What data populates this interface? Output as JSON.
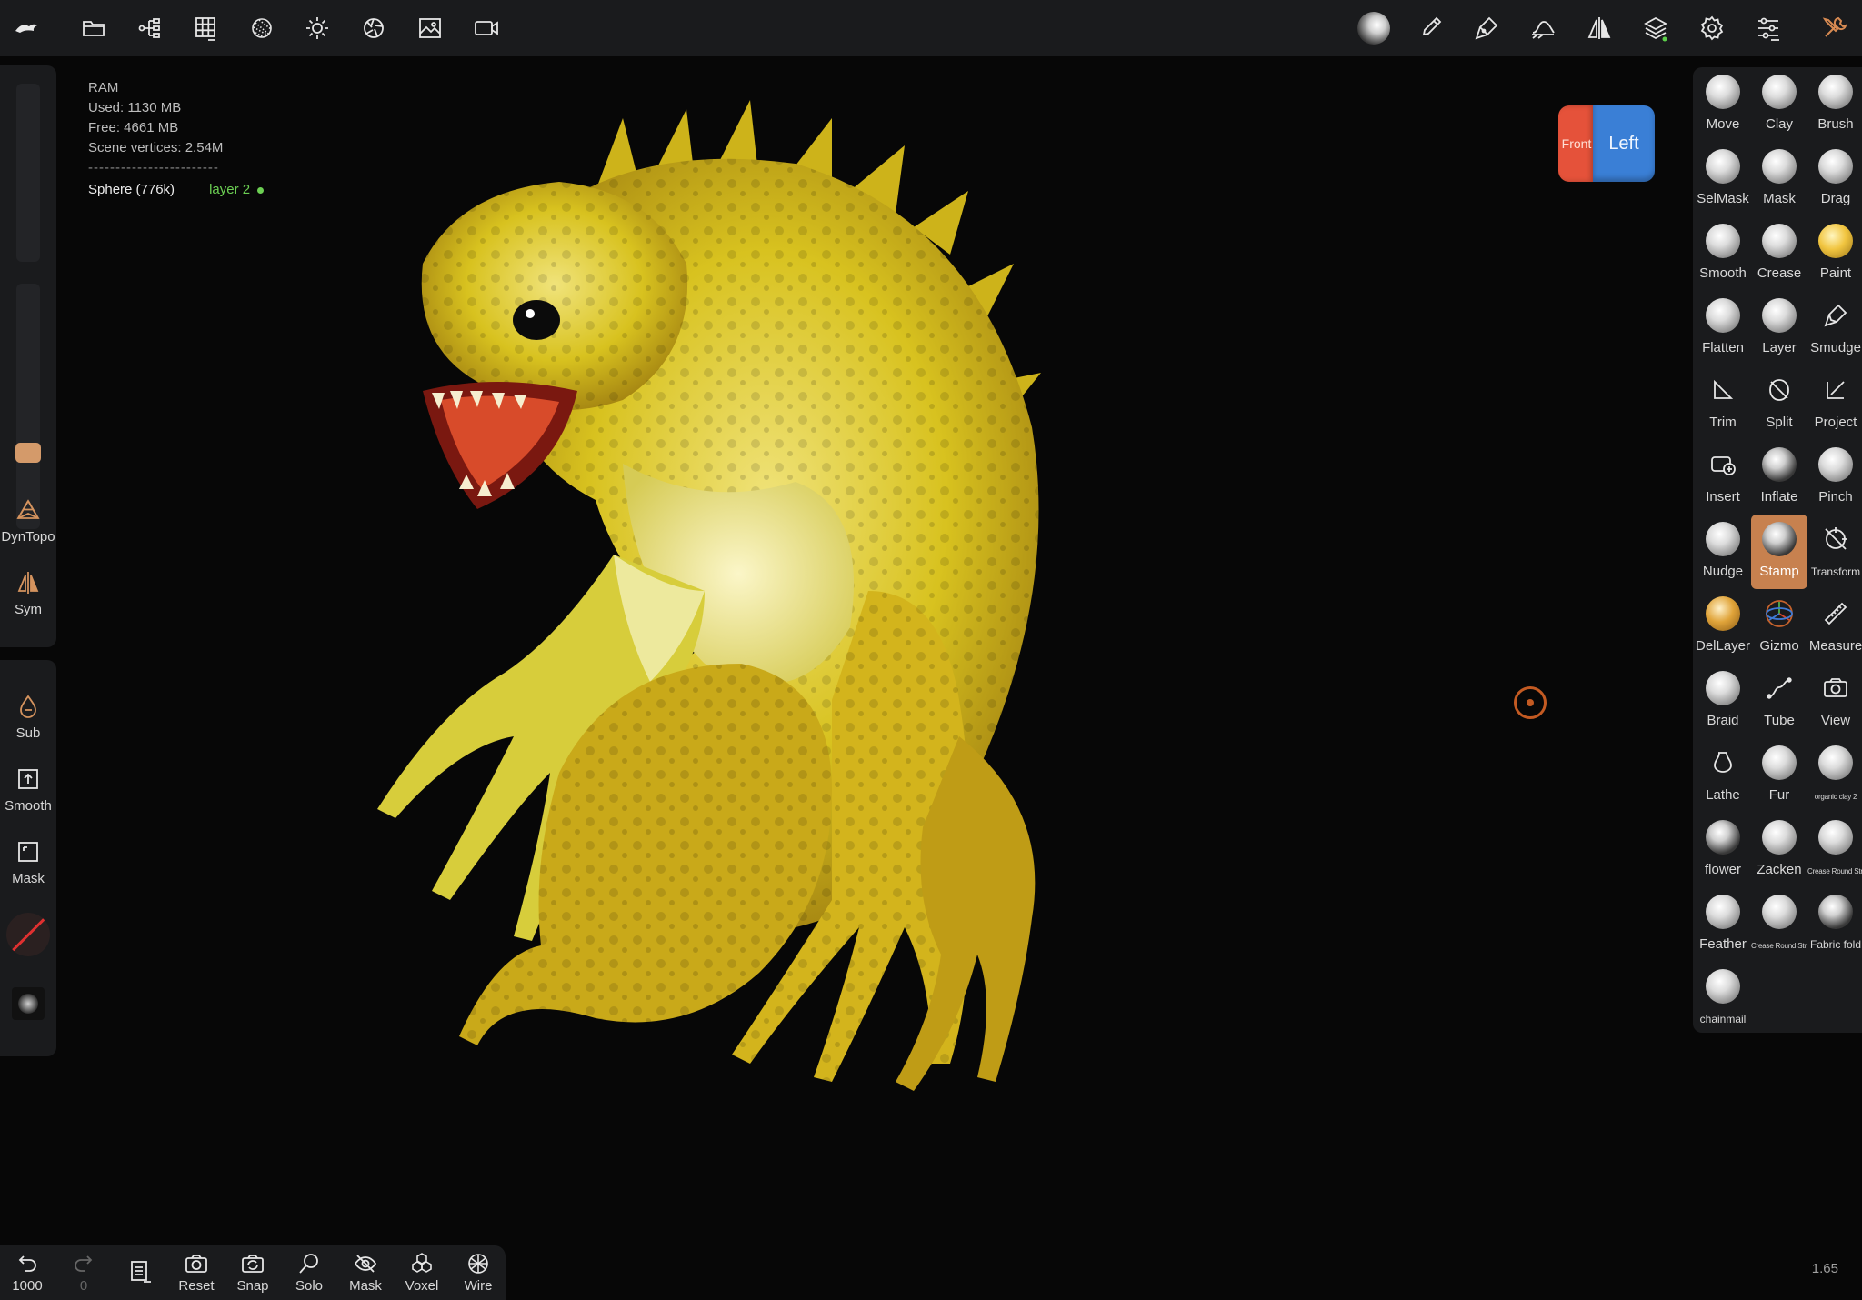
{
  "stats": {
    "ram_label": "RAM",
    "used": "Used: 1130 MB",
    "free": "Free: 4661 MB",
    "vertices": "Scene vertices: 2.54M",
    "separator": "------------------------",
    "object": "Sphere (776k)",
    "layer": "layer 2"
  },
  "viewcube": {
    "front": "Front",
    "left": "Left"
  },
  "left_tools": {
    "dyntopo": "DynTopo",
    "sym": "Sym",
    "sub": "Sub",
    "smooth": "Smooth",
    "mask": "Mask"
  },
  "bottom": {
    "undo": "1000",
    "redo": "0",
    "reset": "Reset",
    "snap": "Snap",
    "solo": "Solo",
    "mask": "Mask",
    "voxel": "Voxel",
    "wire": "Wire"
  },
  "version": "1.65",
  "tools": [
    {
      "label": "Move",
      "icon": "move-ball"
    },
    {
      "label": "Clay",
      "icon": "clay-ball"
    },
    {
      "label": "Brush",
      "icon": "brush-ball"
    },
    {
      "label": "SelMask",
      "icon": "selmask-ball"
    },
    {
      "label": "Mask",
      "icon": "mask-ball"
    },
    {
      "label": "Drag",
      "icon": "drag-ball"
    },
    {
      "label": "Smooth",
      "icon": "smooth-ball"
    },
    {
      "label": "Crease",
      "icon": "crease-ball"
    },
    {
      "label": "Paint",
      "icon": "paint-ball"
    },
    {
      "label": "Flatten",
      "icon": "flatten-ball"
    },
    {
      "label": "Layer",
      "icon": "layer-ball"
    },
    {
      "label": "Smudge",
      "icon": "smudge-icon"
    },
    {
      "label": "Trim",
      "icon": "trim-icon"
    },
    {
      "label": "Split",
      "icon": "split-icon"
    },
    {
      "label": "Project",
      "icon": "project-icon"
    },
    {
      "label": "Insert",
      "icon": "insert-icon"
    },
    {
      "label": "Inflate",
      "icon": "inflate-ball"
    },
    {
      "label": "Pinch",
      "icon": "pinch-ball"
    },
    {
      "label": "Nudge",
      "icon": "nudge-ball"
    },
    {
      "label": "Stamp",
      "icon": "stamp-ball"
    },
    {
      "label": "Transform",
      "icon": "transform-icon"
    },
    {
      "label": "DelLayer",
      "icon": "dellayer-ball"
    },
    {
      "label": "Gizmo",
      "icon": "gizmo-icon"
    },
    {
      "label": "Measure",
      "icon": "measure-icon"
    },
    {
      "label": "Braid",
      "icon": "braid-ball"
    },
    {
      "label": "Tube",
      "icon": "tube-icon"
    },
    {
      "label": "View",
      "icon": "camera-icon"
    },
    {
      "label": "Lathe",
      "icon": "lathe-icon"
    },
    {
      "label": "Fur",
      "icon": "fur-ball"
    },
    {
      "label": "organic clay 2",
      "icon": "organic-clay-ball"
    },
    {
      "label": "flower",
      "icon": "flower-ball"
    },
    {
      "label": "Zacken",
      "icon": "zacken-ball"
    },
    {
      "label": "Crease Round Straight",
      "icon": "crease-round-ball"
    },
    {
      "label": "Feather",
      "icon": "feather-ball"
    },
    {
      "label": "Crease Round Straight",
      "icon": "crease-round-ball"
    },
    {
      "label": "Fabric fold",
      "icon": "fabric-fold-ball"
    },
    {
      "label": "chainmail",
      "icon": "chainmail-ball"
    }
  ],
  "colors": {
    "accent": "#c7814f",
    "panel": "#1a1b1d",
    "layer_green": "#6ccf53",
    "creature": "#d9c31d"
  }
}
